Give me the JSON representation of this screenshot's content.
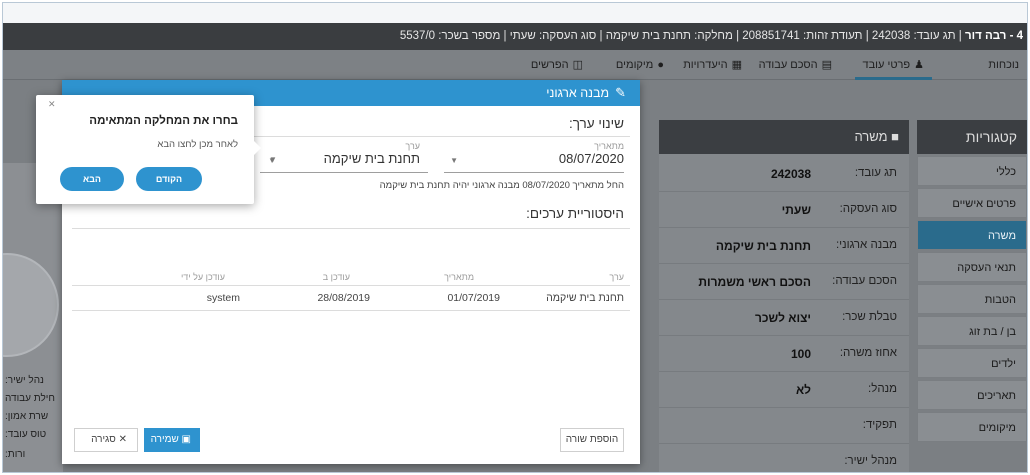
{
  "header": {
    "person_name": "4 - רבה דור",
    "details": " | תג עובד: 242038 | תעודת זהות: 208851741 | מחלקה: תחנת בית שיקמה | סוג העסקה: שעתי | מספר בשכר: 5537/0"
  },
  "tabs": [
    {
      "label": "נוכחות",
      "icon": "",
      "name": "tab-attendance"
    },
    {
      "label": "פרטי עובד",
      "icon": "person-icon",
      "name": "tab-employee-details"
    },
    {
      "label": "הסכם עבודה",
      "icon": "document-icon",
      "name": "tab-work-agreement"
    },
    {
      "label": "היעדרויות",
      "icon": "absence-icon",
      "name": "tab-absences"
    },
    {
      "label": "מיקומים",
      "icon": "location-pin-icon",
      "name": "tab-locations"
    },
    {
      "label": "הפרשים",
      "icon": "differences-icon",
      "name": "tab-differences"
    }
  ],
  "categories": {
    "title": "קטגוריות",
    "items": [
      "כללי",
      "פרטים אישיים",
      "משרה",
      "תנאי העסקה",
      "הטבות",
      "בן / בת זוג",
      "ילדים",
      "תאריכים",
      "מיקומים"
    ]
  },
  "position": {
    "title": "משרה",
    "rows": [
      {
        "label": "תג עובד:",
        "value": "242038"
      },
      {
        "label": "סוג העסקה:",
        "value": "שעתי"
      },
      {
        "label": "מבנה ארגוני:",
        "value": "תחנת בית שיקמה"
      },
      {
        "label": "הסכם עבודה:",
        "value": "הסכם ראשי משמרות"
      },
      {
        "label": "טבלת שכר:",
        "value": "יצוא לשכר"
      },
      {
        "label": "אחוז משרה:",
        "value": "100"
      },
      {
        "label": "מנהל:",
        "value": "לא"
      },
      {
        "label": "תפקיד:",
        "value": ""
      },
      {
        "label": "מנהל ישיר:",
        "value": ""
      }
    ]
  },
  "left_labels": [
    "נהל ישיר:",
    "חילת עבודה",
    "שרת אמון:",
    "טוס עובד:",
    "ורות:"
  ],
  "dialog": {
    "title": "מבנה ארגוני",
    "change_title": "שינוי ערך:",
    "from_date_label": "מתאריך",
    "from_date_value": "08/07/2020",
    "value_label": "ערך",
    "value_value": "תחנת בית שיקמה",
    "note": "החל מתאריך 08/07/2020 מבנה ארגוני יהיה תחנת בית שיקמה",
    "history_title": "היסטוריית ערכים:",
    "columns": [
      "ערך",
      "מתאריך",
      "עודכן ב",
      "עודכן על ידי"
    ],
    "rows": [
      [
        "תחנת בית שיקמה",
        "01/07/2019",
        "28/08/2019",
        "system"
      ]
    ],
    "add_row": "הוספת שורה",
    "save": "שמירה",
    "close": "סגירה"
  },
  "popover": {
    "title": "בחרו את המחלקה המתאימה",
    "subtitle": "לאחר מכן לחצו הבא",
    "prev": "הקודם",
    "next": "הבא"
  },
  "colors": {
    "accent": "#2e93cf",
    "active_category": "#2a6b8c",
    "title_bar": "#3a3d40"
  }
}
